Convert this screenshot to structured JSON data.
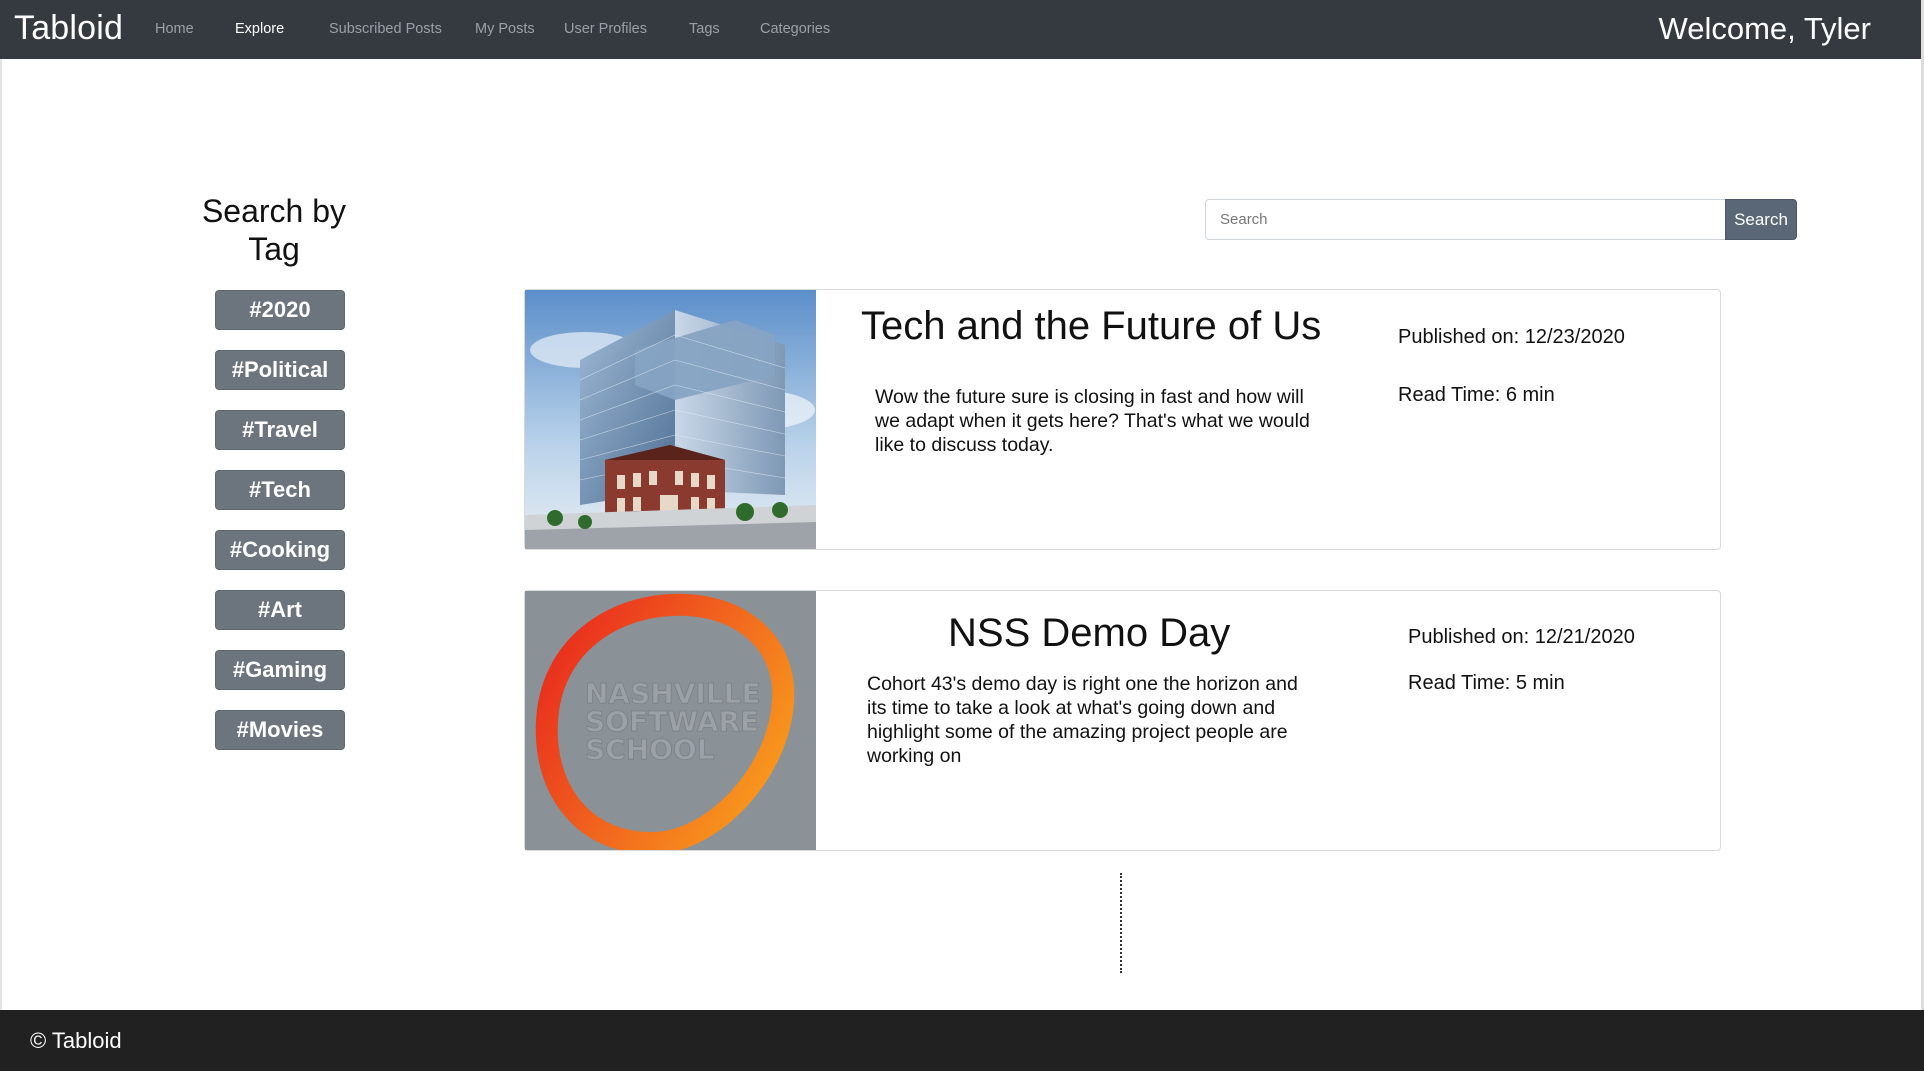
{
  "navbar": {
    "brand": "Tabloid",
    "links": [
      {
        "label": "Home"
      },
      {
        "label": "Explore"
      },
      {
        "label": "Subscribed Posts"
      },
      {
        "label": "My Posts"
      },
      {
        "label": "User Profiles"
      },
      {
        "label": "Tags"
      },
      {
        "label": "Categories"
      }
    ],
    "active": "Explore",
    "welcome": "Welcome, Tyler"
  },
  "sidebar": {
    "title_line1": "Search by",
    "title_line2": "Tag",
    "tags": [
      "#2020",
      "#Political",
      "#Travel",
      "#Tech",
      "#Cooking",
      "#Art",
      "#Gaming",
      "#Movies"
    ]
  },
  "search": {
    "placeholder": "Search",
    "button_label": "Search"
  },
  "posts": [
    {
      "title": "Tech and the Future of Us",
      "body": "Wow the future sure is closing in fast and how will we adapt when it gets here? That's what we would like to discuss today.",
      "published": "Published on: 12/23/2020",
      "read_time": "Read Time: 6 min"
    },
    {
      "title": "NSS Demo Day",
      "body": "Cohort 43's demo day is right one the horizon and its time to take a look at what's going down and highlight some of the amazing project people are working on",
      "published": "Published on: 12/21/2020",
      "read_time": "Read Time: 5 min",
      "logo_text": [
        "NASHVILLE",
        "SOFTWARE",
        "SCHOOL"
      ]
    }
  ],
  "footer": {
    "text": "© Tabloid"
  },
  "colors": {
    "navbar_bg": "#343a40",
    "tag_button_bg": "#6c757d",
    "search_button_bg": "#596776",
    "footer_bg": "#212121",
    "logo_gray": "#8a9197",
    "logo_gradient_start": "#e8231e",
    "logo_gradient_end": "#f7941d"
  }
}
